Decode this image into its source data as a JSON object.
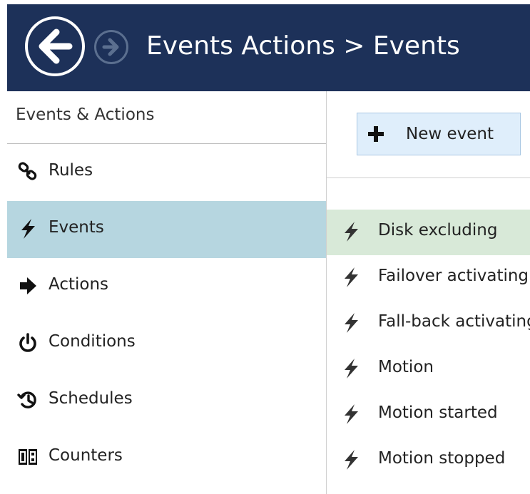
{
  "header": {
    "title": "Events  Actions > Events",
    "back_icon": "back-arrow-icon",
    "forward_icon": "forward-arrow-icon",
    "background": "#1d3159"
  },
  "sidebar": {
    "heading": "Events & Actions",
    "items": [
      {
        "label": "Rules",
        "icon": "link-icon",
        "active": false
      },
      {
        "label": "Events",
        "icon": "lightning-icon",
        "active": true
      },
      {
        "label": "Actions",
        "icon": "arrow-right-icon",
        "active": false
      },
      {
        "label": "Conditions",
        "icon": "power-icon",
        "active": false
      },
      {
        "label": "Schedules",
        "icon": "history-icon",
        "active": false
      },
      {
        "label": "Counters",
        "icon": "counter-icon",
        "active": false
      }
    ],
    "active_color": "#b6d6e0"
  },
  "toolbar": {
    "new_event_label": "New event"
  },
  "events": {
    "items": [
      {
        "label": "Disk excluding",
        "selected": true
      },
      {
        "label": "Failover activating",
        "selected": false
      },
      {
        "label": "Fall-back activating",
        "selected": false
      },
      {
        "label": "Motion",
        "selected": false
      },
      {
        "label": "Motion started",
        "selected": false
      },
      {
        "label": "Motion stopped",
        "selected": false
      }
    ],
    "selected_color": "#d8e9d8"
  }
}
